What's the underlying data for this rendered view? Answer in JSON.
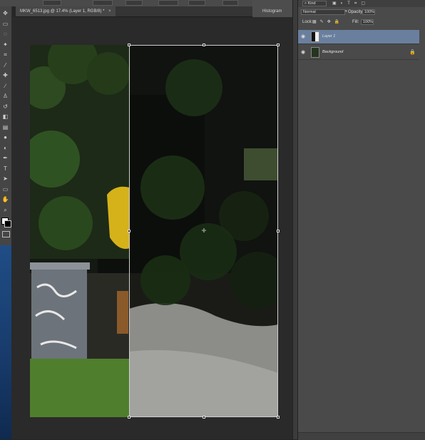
{
  "document": {
    "tab_title": "MKW_6513.jpg @ 17.4% (Layer 1, RGB/8) *",
    "close_glyph": "×"
  },
  "panel_tabs": {
    "histogram": "Histogram"
  },
  "layers_panel": {
    "kind_label": "Kind",
    "blend_mode": "Normal",
    "opacity_label": "Opacity:",
    "opacity_value": "100%",
    "lock_label": "Lock:",
    "fill_label": "Fill:",
    "fill_value": "100%",
    "layers": [
      {
        "name": "Layer 1",
        "selected": true,
        "locked": false
      },
      {
        "name": "Background",
        "selected": false,
        "locked": true
      }
    ]
  },
  "toolbar": {
    "tools": [
      "move-icon",
      "marquee-icon",
      "lasso-icon",
      "quick-select-icon",
      "crop-icon",
      "eyedropper-icon",
      "healing-icon",
      "brush-icon",
      "clone-stamp-icon",
      "history-brush-icon",
      "eraser-icon",
      "gradient-icon",
      "blur-icon",
      "dodge-icon",
      "pen-icon",
      "type-icon",
      "path-select-icon",
      "shape-icon",
      "hand-icon",
      "zoom-icon"
    ],
    "glyphs": [
      "✥",
      "▭",
      "◌",
      "✦",
      "⌗",
      "⁄",
      "✚",
      "∕",
      "♙",
      "↺",
      "◧",
      "▤",
      "●",
      "◐",
      "✒",
      "T",
      "➤",
      "▭",
      "✋",
      "⌕"
    ]
  },
  "colors": {
    "panel_bg": "#4a4a4a",
    "selected_layer": "#6a7f9e",
    "canvas_bg": "#2a2a2a"
  }
}
